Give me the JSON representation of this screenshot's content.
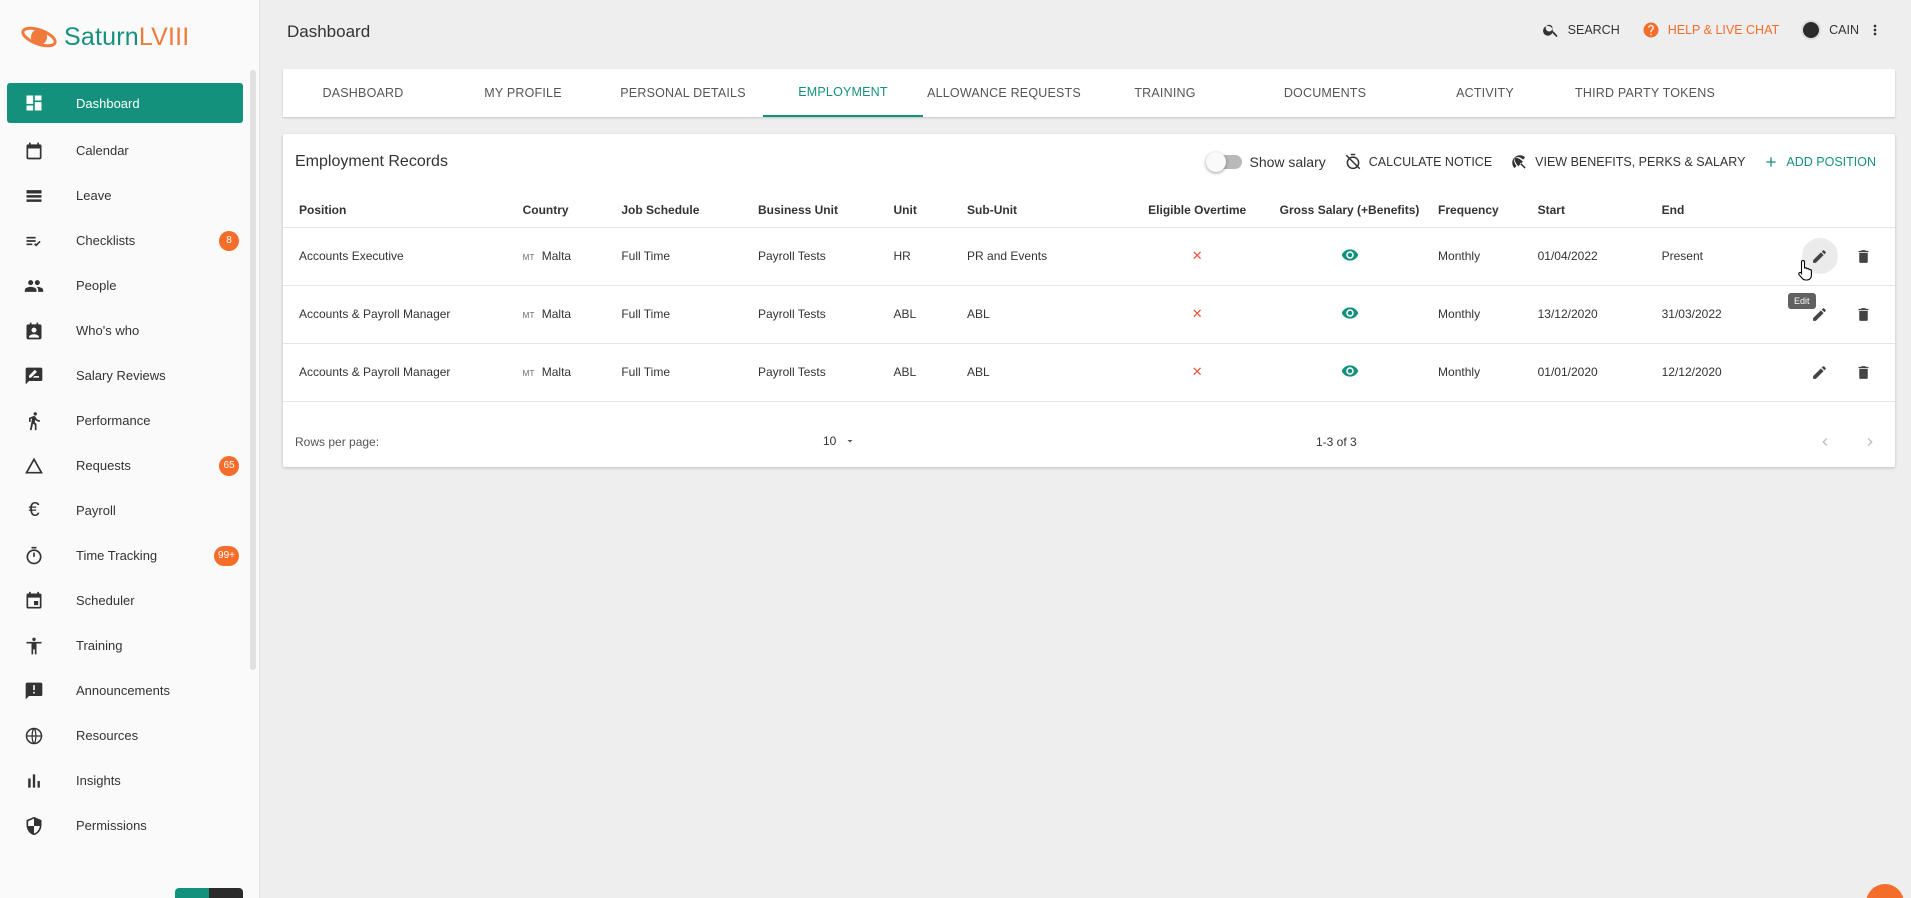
{
  "brand": {
    "name_part1": "Saturn",
    "name_part2": "LVIII",
    "primary": "#14917c",
    "accent": "#f46d2a"
  },
  "header": {
    "title": "Dashboard",
    "search_label": "SEARCH",
    "help_label": "HELP & LIVE CHAT",
    "user_label": "CAIN"
  },
  "sidebar": {
    "items": [
      {
        "label": "Dashboard",
        "icon": "dashboard-icon",
        "active": true
      },
      {
        "label": "Calendar",
        "icon": "calendar-icon"
      },
      {
        "label": "Leave",
        "icon": "leave-icon"
      },
      {
        "label": "Checklists",
        "icon": "checklist-icon",
        "badge": "8"
      },
      {
        "label": "People",
        "icon": "people-icon"
      },
      {
        "label": "Who's who",
        "icon": "badge-icon"
      },
      {
        "label": "Salary Reviews",
        "icon": "rate-review-icon"
      },
      {
        "label": "Performance",
        "icon": "run-icon"
      },
      {
        "label": "Requests",
        "icon": "triangle-icon",
        "badge": "65"
      },
      {
        "label": "Payroll",
        "icon": "euro-icon"
      },
      {
        "label": "Time Tracking",
        "icon": "timer-icon",
        "badge": "99+"
      },
      {
        "label": "Scheduler",
        "icon": "event-icon"
      },
      {
        "label": "Training",
        "icon": "accessibility-icon"
      },
      {
        "label": "Announcements",
        "icon": "announcement-icon"
      },
      {
        "label": "Resources",
        "icon": "globe-icon"
      },
      {
        "label": "Insights",
        "icon": "bar-chart-icon"
      },
      {
        "label": "Permissions",
        "icon": "shield-icon"
      }
    ]
  },
  "tabs": [
    {
      "label": "DASHBOARD"
    },
    {
      "label": "MY PROFILE"
    },
    {
      "label": "PERSONAL DETAILS"
    },
    {
      "label": "EMPLOYMENT",
      "active": true
    },
    {
      "label": "ALLOWANCE REQUESTS"
    },
    {
      "label": "TRAINING"
    },
    {
      "label": "DOCUMENTS"
    },
    {
      "label": "ACTIVITY"
    },
    {
      "label": "THIRD PARTY TOKENS"
    }
  ],
  "card": {
    "title": "Employment Records",
    "show_salary_label": "Show salary",
    "show_salary_on": false,
    "calculate_notice_label": "CALCULATE NOTICE",
    "view_benefits_label": "VIEW BENEFITS, PERKS & SALARY",
    "add_position_label": "ADD POSITION"
  },
  "table": {
    "columns": [
      "Position",
      "Country",
      "Job Schedule",
      "Business Unit",
      "Unit",
      "Sub-Unit",
      "Eligible Overtime",
      "Gross Salary (+Benefits)",
      "Frequency",
      "Start",
      "End"
    ],
    "rows": [
      {
        "position": "Accounts Executive",
        "country_code": "MT",
        "country": "Malta",
        "schedule": "Full Time",
        "business_unit": "Payroll Tests",
        "unit": "HR",
        "sub_unit": "PR and Events",
        "overtime": "✕",
        "frequency": "Monthly",
        "start": "01/04/2022",
        "end": "Present"
      },
      {
        "position": "Accounts & Payroll Manager",
        "country_code": "MT",
        "country": "Malta",
        "schedule": "Full Time",
        "business_unit": "Payroll Tests",
        "unit": "ABL",
        "sub_unit": "ABL",
        "overtime": "✕",
        "frequency": "Monthly",
        "start": "13/12/2020",
        "end": "31/03/2022"
      },
      {
        "position": "Accounts & Payroll Manager",
        "country_code": "MT",
        "country": "Malta",
        "schedule": "Full Time",
        "business_unit": "Payroll Tests",
        "unit": "ABL",
        "sub_unit": "ABL",
        "overtime": "✕",
        "frequency": "Monthly",
        "start": "01/01/2020",
        "end": "12/12/2020"
      }
    ]
  },
  "tooltip": {
    "text": "Edit"
  },
  "pagination": {
    "rows_per_page_label": "Rows per page:",
    "rows_per_page": "10",
    "range": "1-3 of 3"
  }
}
